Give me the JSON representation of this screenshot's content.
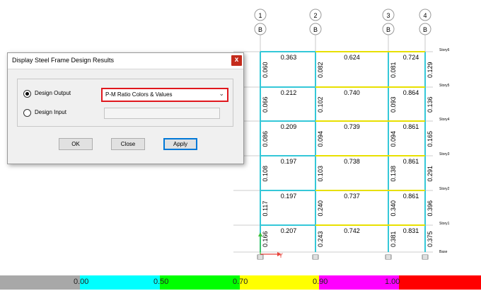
{
  "grid_axes": [
    {
      "number": "1",
      "letter": "B"
    },
    {
      "number": "2",
      "letter": "B"
    },
    {
      "number": "3",
      "letter": "B"
    },
    {
      "number": "4",
      "letter": "B"
    }
  ],
  "stories": [
    "Story6",
    "Story5",
    "Story4",
    "Story3",
    "Story2",
    "Story1",
    "Base"
  ],
  "beam_ratios": [
    [
      "0.363",
      "0.624",
      "0.724"
    ],
    [
      "0.212",
      "0.740",
      "0.864"
    ],
    [
      "0.209",
      "0.739",
      "0.861"
    ],
    [
      "0.197",
      "0.738",
      "0.861"
    ],
    [
      "0.197",
      "0.737",
      "0.861"
    ],
    [
      "0.207",
      "0.742",
      "0.831"
    ]
  ],
  "column_ratios": [
    [
      "0.060",
      "0.082",
      "0.081",
      "0.129"
    ],
    [
      "0.066",
      "0.102",
      "0.093",
      "0.136"
    ],
    [
      "0.086",
      "0.094",
      "0.094",
      "0.165"
    ],
    [
      "0.108",
      "0.103",
      "0.138",
      "0.291"
    ],
    [
      "0.117",
      "0.240",
      "0.340",
      "0.396"
    ],
    [
      "0.166",
      "0.243",
      "0.381",
      "0.375"
    ]
  ],
  "axis_labels": {
    "y": "Y"
  },
  "colors": {
    "column": "#35c8d8",
    "beam_low": "#35c8d8",
    "beam_mid": "#e8e000",
    "beam_high": "#e8e000",
    "grid": "#bdbdbd",
    "axis_y": "#e8453c",
    "axis_z": "#3ac23a"
  },
  "dialog": {
    "title": "Display Steel Frame Design Results",
    "close_label": "x",
    "design_output_label": "Design Output",
    "design_input_label": "Design Input",
    "selected_option": "P-M Ratio Colors & Values",
    "selected_radio": "design_output",
    "buttons": {
      "ok": "OK",
      "close": "Close",
      "apply": "Apply"
    }
  },
  "legend": {
    "segments": [
      {
        "color": "#a8a8a8"
      },
      {
        "color": "#00ffff"
      },
      {
        "color": "#00ff00"
      },
      {
        "color": "#ffff00"
      },
      {
        "color": "#ff00ff"
      },
      {
        "color": "#ff0000"
      }
    ],
    "ticks": [
      "0.00",
      "0.50",
      "0.70",
      "0.90",
      "1.00"
    ]
  }
}
